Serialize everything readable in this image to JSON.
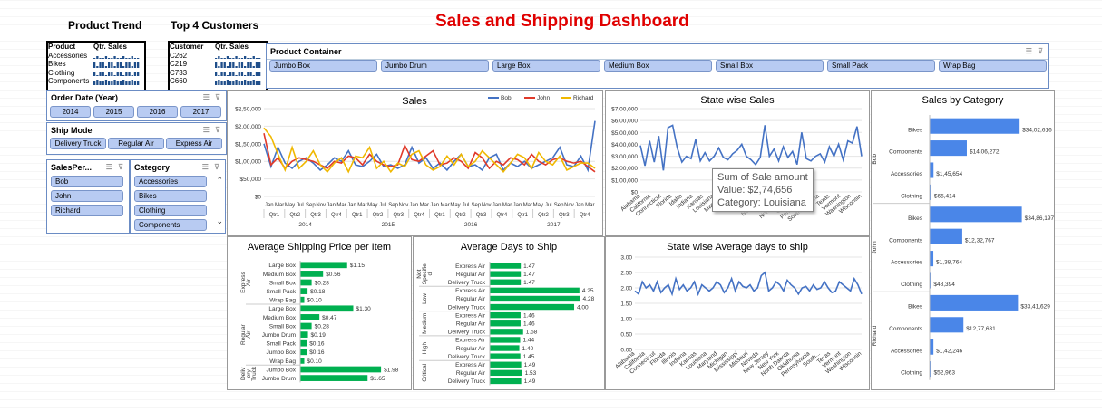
{
  "title": "Sales and Shipping Dashboard",
  "headers": {
    "product_trend": "Product Trend",
    "top_customers": "Top 4 Customers"
  },
  "product_mini": {
    "col1": "Product",
    "col2": "Qtr. Sales",
    "rows": [
      "Accessories",
      "Bikes",
      "Clothing",
      "Components"
    ]
  },
  "customer_mini": {
    "col1": "Customer",
    "col2": "Qtr. Sales",
    "rows": [
      "C262",
      "C219",
      "C733",
      "C660"
    ]
  },
  "product_container": {
    "title": "Product Container",
    "items": [
      "Jumbo Box",
      "Jumbo Drum",
      "Large Box",
      "Medium Box",
      "Small Box",
      "Small Pack",
      "Wrap Bag"
    ]
  },
  "order_date": {
    "title": "Order Date (Year)",
    "items": [
      "2014",
      "2015",
      "2016",
      "2017"
    ]
  },
  "ship_mode": {
    "title": "Ship Mode",
    "items": [
      "Delivery Truck",
      "Regular Air",
      "Express Air"
    ]
  },
  "salesperson": {
    "title": "SalesPer...",
    "items": [
      "Bob",
      "John",
      "Richard"
    ]
  },
  "category": {
    "title": "Category",
    "items": [
      "Accessories",
      "Bikes",
      "Clothing",
      "Components"
    ]
  },
  "tooltip": {
    "line1": "Sum of Sale amount",
    "line2": "Value: $2,74,656",
    "line3": "Category: Louisiana"
  },
  "chart_data": [
    {
      "type": "line",
      "title": "Sales",
      "ylim": [
        0,
        250000
      ],
      "yticks": [
        "$0",
        "$50,000",
        "$1,00,000",
        "$1,50,000",
        "$2,00,000",
        "$2,50,000"
      ],
      "months": [
        "Jan",
        "Mar",
        "May",
        "Jul",
        "Sep",
        "Nov"
      ],
      "quarters": [
        "Qtr1",
        "Qtr2",
        "Qtr3",
        "Qtr4"
      ],
      "years": [
        "2014",
        "2015",
        "2016",
        "2017"
      ],
      "legend": "top-right",
      "series": [
        {
          "name": "Bob",
          "color": "#4472c4",
          "values": [
            150000,
            85000,
            140000,
            95000,
            80000,
            100000,
            110000,
            95000,
            75000,
            90000,
            110000,
            100000,
            130000,
            90000,
            85000,
            100000,
            120000,
            85000,
            90000,
            80000,
            90000,
            140000,
            95000,
            110000,
            80000,
            95000,
            75000,
            100000,
            120000,
            85000,
            90000,
            75000,
            110000,
            120000,
            75000,
            95000,
            85000,
            100000,
            80000,
            90000,
            100000,
            110000,
            140000,
            90000,
            85000,
            115000,
            75000,
            215000
          ]
        },
        {
          "name": "John",
          "color": "#e03a2a",
          "values": [
            180000,
            90000,
            110000,
            80000,
            100000,
            110000,
            105000,
            100000,
            90000,
            80000,
            100000,
            95000,
            115000,
            110000,
            90000,
            120000,
            100000,
            90000,
            85000,
            90000,
            145000,
            105000,
            100000,
            115000,
            130000,
            90000,
            95000,
            110000,
            100000,
            80000,
            125000,
            110000,
            80000,
            100000,
            90000,
            110000,
            105000,
            90000,
            120000,
            100000,
            90000,
            105000,
            110000,
            100000,
            95000,
            100000,
            85000,
            70000
          ]
        },
        {
          "name": "Richard",
          "color": "#f0b800",
          "values": [
            195000,
            170000,
            120000,
            75000,
            140000,
            80000,
            100000,
            130000,
            90000,
            70000,
            95000,
            110000,
            70000,
            115000,
            110000,
            140000,
            80000,
            100000,
            70000,
            95000,
            85000,
            120000,
            130000,
            90000,
            75000,
            85000,
            115000,
            90000,
            120000,
            85000,
            100000,
            130000,
            110000,
            90000,
            70000,
            95000,
            120000,
            110000,
            80000,
            125000,
            100000,
            90000,
            115000,
            75000,
            85000,
            95000,
            95000,
            80000
          ]
        }
      ]
    },
    {
      "type": "line",
      "title": "State wise Sales",
      "ylim": [
        0,
        700000
      ],
      "yticks": [
        "$0",
        "$1,00,000",
        "$2,00,000",
        "$3,00,000",
        "$4,00,000",
        "$5,00,000",
        "$6,00,000",
        "$7,00,000"
      ],
      "x": [
        "Alabama",
        "California",
        "Connecticut",
        "Florida",
        "Idaho",
        "Indiana",
        "Kansas",
        "Louisiana",
        "Maryland",
        "Michigan",
        "Missouri",
        "Nevada",
        "New Jersey",
        "New York",
        "North Dakota",
        "Oklahoma",
        "Pennsylvania",
        "South Carolina",
        "Texas",
        "Vermont",
        "Washington",
        "Wisconsin"
      ],
      "values": [
        390000,
        220000,
        430000,
        250000,
        470000,
        180000,
        540000,
        560000,
        370000,
        250000,
        300000,
        280000,
        440000,
        260000,
        330000,
        260000,
        300000,
        370000,
        290000,
        270000,
        320000,
        350000,
        400000,
        300000,
        270000,
        230000,
        290000,
        560000,
        300000,
        360000,
        260000,
        380000,
        290000,
        340000,
        230000,
        500000,
        280000,
        260000,
        300000,
        320000,
        250000,
        380000,
        300000,
        400000,
        270000,
        430000,
        410000,
        550000,
        300000
      ]
    },
    {
      "type": "line",
      "title": "State wise Average days to ship",
      "ylim": [
        0,
        3
      ],
      "yticks": [
        "0.00",
        "0.50",
        "1.00",
        "1.50",
        "2.00",
        "2.50",
        "3.00"
      ],
      "x": [
        "Alabama",
        "California",
        "Connecticut",
        "Florida",
        "Illinois",
        "Indiana",
        "Kansas",
        "Louisiana",
        "Maryland",
        "Michigan",
        "Mississippi",
        "Missouri",
        "Nevada",
        "New Jersey",
        "New York",
        "North Dakota",
        "Oklahoma",
        "Pennsylvania",
        "South...",
        "Texas",
        "Vermont",
        "Washington",
        "Wisconsin"
      ],
      "values": [
        1.9,
        1.8,
        2.2,
        2.0,
        2.1,
        1.9,
        2.2,
        1.85,
        2.0,
        2.1,
        1.8,
        2.3,
        1.95,
        2.1,
        1.9,
        2.0,
        2.2,
        1.8,
        2.1,
        2.0,
        1.9,
        2.0,
        2.2,
        2.1,
        1.85,
        2.0,
        2.3,
        1.9,
        2.2,
        2.05,
        2.0,
        2.1,
        1.9,
        2.0,
        2.4,
        2.5,
        1.9,
        2.0,
        2.2,
        2.1,
        1.9,
        2.25,
        2.1,
        2.0,
        1.8,
        2.0,
        2.05,
        1.9,
        2.1,
        1.95,
        2.0,
        2.2,
        2.0,
        1.85,
        1.9,
        2.2,
        2.1,
        2.0,
        1.9,
        2.3,
        2.1,
        1.8
      ]
    },
    {
      "type": "bar",
      "title": "Average Shipping Price per Item",
      "bar_color": "#00b050",
      "max": 2.0,
      "groups": [
        {
          "name": "Express Air",
          "rows": [
            [
              "Large Box",
              1.15,
              "$1.15"
            ],
            [
              "Medium Box",
              0.56,
              "$0.56"
            ],
            [
              "Small Box",
              0.28,
              "$0.28"
            ],
            [
              "Small Pack",
              0.18,
              "$0.18"
            ],
            [
              "Wrap Bag",
              0.1,
              "$0.10"
            ]
          ]
        },
        {
          "name": "Regular Air",
          "rows": [
            [
              "Large Box",
              1.3,
              "$1.30"
            ],
            [
              "Medium Box",
              0.47,
              "$0.47"
            ],
            [
              "Small Box",
              0.28,
              "$0.28"
            ],
            [
              "Jumbo Drum",
              0.19,
              "$0.19"
            ],
            [
              "Small Pack",
              0.16,
              "$0.16"
            ],
            [
              "Jumbo Box",
              0.16,
              "$0.16"
            ],
            [
              "Wrap Bag",
              0.1,
              "$0.10"
            ]
          ]
        },
        {
          "name": "Deliv ery Truck",
          "rows": [
            [
              "Jumbo Box",
              1.98,
              "$1.98"
            ],
            [
              "Jumbo Drum",
              1.65,
              "$1.65"
            ]
          ]
        }
      ]
    },
    {
      "type": "bar",
      "title": "Average Days to Ship",
      "bar_color": "#00b050",
      "max": 4.3,
      "groups": [
        {
          "name": "Not Specifie d",
          "rows": [
            [
              "Express Air",
              1.47,
              "1.47"
            ],
            [
              "Regular Air",
              1.47,
              "1.47"
            ],
            [
              "Delivery Truck",
              1.47,
              "1.47"
            ]
          ]
        },
        {
          "name": "Low",
          "rows": [
            [
              "Express Air",
              4.25,
              "4.25"
            ],
            [
              "Regular Air",
              4.28,
              "4.28"
            ],
            [
              "Delivery Truck",
              4.0,
              "4.00"
            ]
          ]
        },
        {
          "name": "Medium",
          "rows": [
            [
              "Express Air",
              1.46,
              "1.46"
            ],
            [
              "Regular Air",
              1.46,
              "1.46"
            ],
            [
              "Delivery Truck",
              1.58,
              "1.58"
            ]
          ]
        },
        {
          "name": "High",
          "rows": [
            [
              "Express Air",
              1.44,
              "1.44"
            ],
            [
              "Regular Air",
              1.4,
              "1.40"
            ],
            [
              "Delivery Truck",
              1.45,
              "1.45"
            ]
          ]
        },
        {
          "name": "Critical",
          "rows": [
            [
              "Express Air",
              1.49,
              "1.49"
            ],
            [
              "Regular Air",
              1.53,
              "1.53"
            ],
            [
              "Delivery Truck",
              1.49,
              "1.49"
            ]
          ]
        }
      ]
    },
    {
      "type": "bar",
      "title": "Sales by Category",
      "bar_color": "#4a86e8",
      "max": 3500000,
      "groups": [
        {
          "name": "Bob",
          "rows": [
            [
              "Bikes",
              3402616,
              "$34,02,616"
            ],
            [
              "Components",
              1406272,
              "$14,06,272"
            ],
            [
              "Accessories",
              145654,
              "$1,45,654"
            ],
            [
              "Clothing",
              65414,
              "$65,414"
            ]
          ]
        },
        {
          "name": "John",
          "rows": [
            [
              "Bikes",
              3486197,
              "$34,86,197"
            ],
            [
              "Components",
              1232767,
              "$12,32,767"
            ],
            [
              "Accessories",
              138764,
              "$1,38,764"
            ],
            [
              "Clothing",
              48394,
              "$48,394"
            ]
          ]
        },
        {
          "name": "Richard",
          "rows": [
            [
              "Bikes",
              3341629,
              "$33,41,629"
            ],
            [
              "Components",
              1277631,
              "$12,77,631"
            ],
            [
              "Accessories",
              142246,
              "$1,42,246"
            ],
            [
              "Clothing",
              52963,
              "$52,963"
            ]
          ]
        }
      ]
    }
  ]
}
